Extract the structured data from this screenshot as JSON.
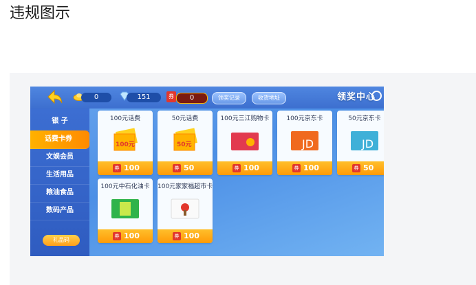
{
  "page": {
    "title": "违规图示"
  },
  "game": {
    "topbar": {
      "silver_count": "0",
      "diamond_count": "151",
      "ticket_count": "0",
      "claim_record_label": "领奖记录",
      "address_label": "收货地址",
      "title": "领奖中心"
    },
    "sidebar": {
      "items": [
        {
          "label": "银 子"
        },
        {
          "label": "话费卡券"
        },
        {
          "label": "文娱会员"
        },
        {
          "label": "生活用品"
        },
        {
          "label": "粮油食品"
        },
        {
          "label": "数码产品"
        }
      ],
      "gift_code_label": "礼品码"
    },
    "cards": [
      {
        "name": "100元话费",
        "price": "100",
        "ticket_label": "券",
        "icon": "phone-bill-100-icon",
        "img_text": "100元"
      },
      {
        "name": "50元话费",
        "price": "50",
        "ticket_label": "券",
        "icon": "phone-bill-50-icon",
        "img_text": "50元"
      },
      {
        "name": "100元三江购物卡",
        "price": "100",
        "ticket_label": "券",
        "icon": "sanjiang-card-icon"
      },
      {
        "name": "100元京东卡",
        "price": "100",
        "ticket_label": "券",
        "icon": "jd-card-icon",
        "img_text": "JD"
      },
      {
        "name": "50元京东卡",
        "price": "50",
        "ticket_label": "券",
        "icon": "jd-card-icon",
        "img_text": "JD"
      },
      {
        "name": "100元中石化油卡",
        "price": "100",
        "ticket_label": "券",
        "icon": "sinopec-card-icon"
      },
      {
        "name": "100元家家福超市卡",
        "price": "100",
        "ticket_label": "券",
        "icon": "jiajiafu-card-icon"
      }
    ]
  }
}
